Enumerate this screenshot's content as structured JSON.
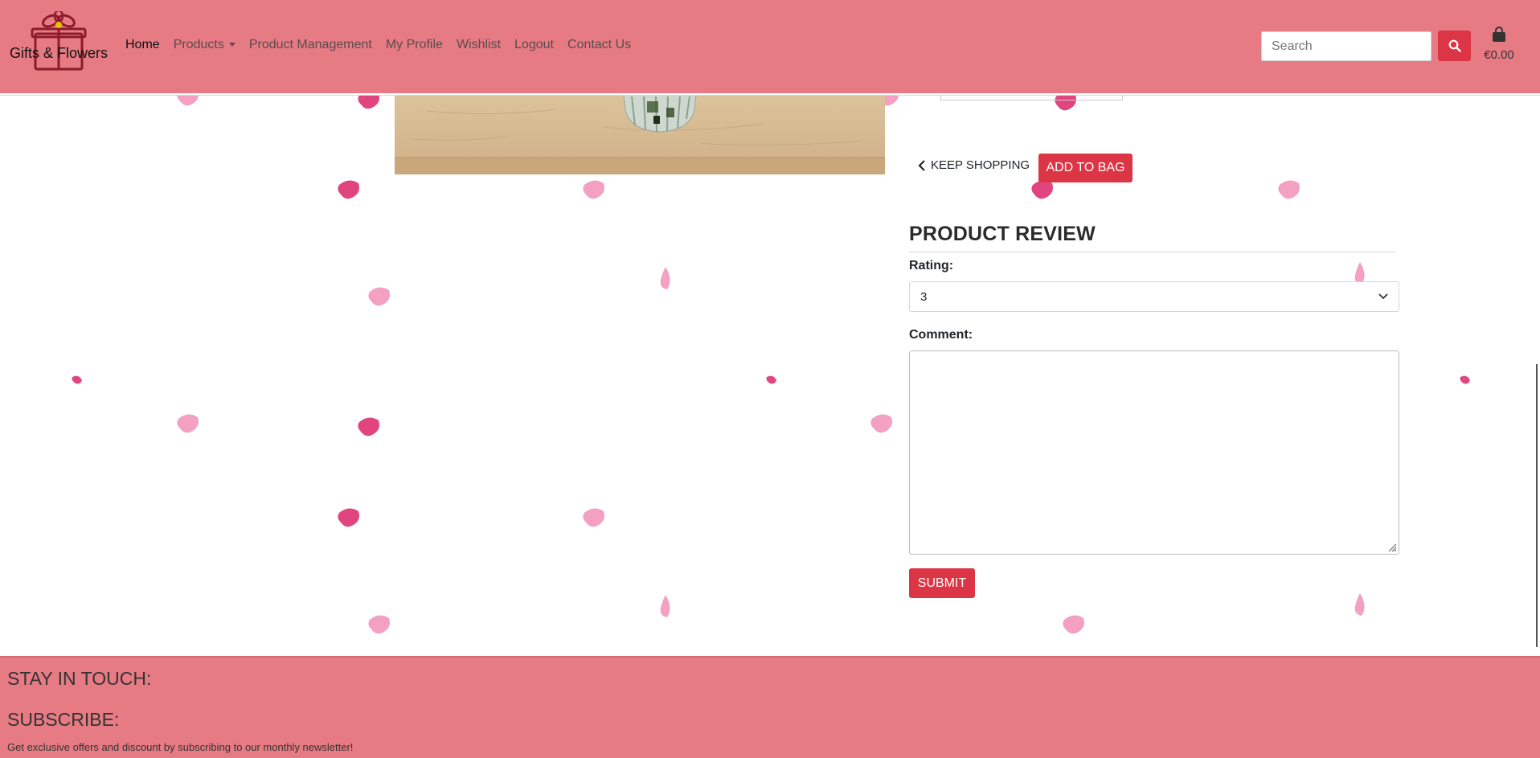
{
  "brand": {
    "name": "Gifts & Flowers"
  },
  "nav": {
    "links": [
      "Home",
      "Products",
      "Product Management",
      "My Profile",
      "Wishlist",
      "Logout",
      "Contact Us"
    ]
  },
  "search": {
    "placeholder": "Search"
  },
  "cart": {
    "total": "€0.00"
  },
  "product": {
    "keep_shopping_label": "KEEP SHOPPING",
    "add_to_bag_label": "ADD TO BAG"
  },
  "review": {
    "title": "PRODUCT REVIEW",
    "rating_label": "Rating:",
    "rating_value": "3",
    "comment_label": "Comment:",
    "submit_label": "SUBMIT"
  },
  "footer": {
    "stay_in_touch": "STAY IN TOUCH:",
    "subscribe": "SUBSCRIBE:",
    "subscribe_text": "Get exclusive offers and discount by subscribing to our monthly newsletter!"
  },
  "colors": {
    "header_bg": "#e67b84",
    "accent": "#dc3545",
    "petal_dark": "#e0457f",
    "petal_light": "#f3a0c2"
  }
}
